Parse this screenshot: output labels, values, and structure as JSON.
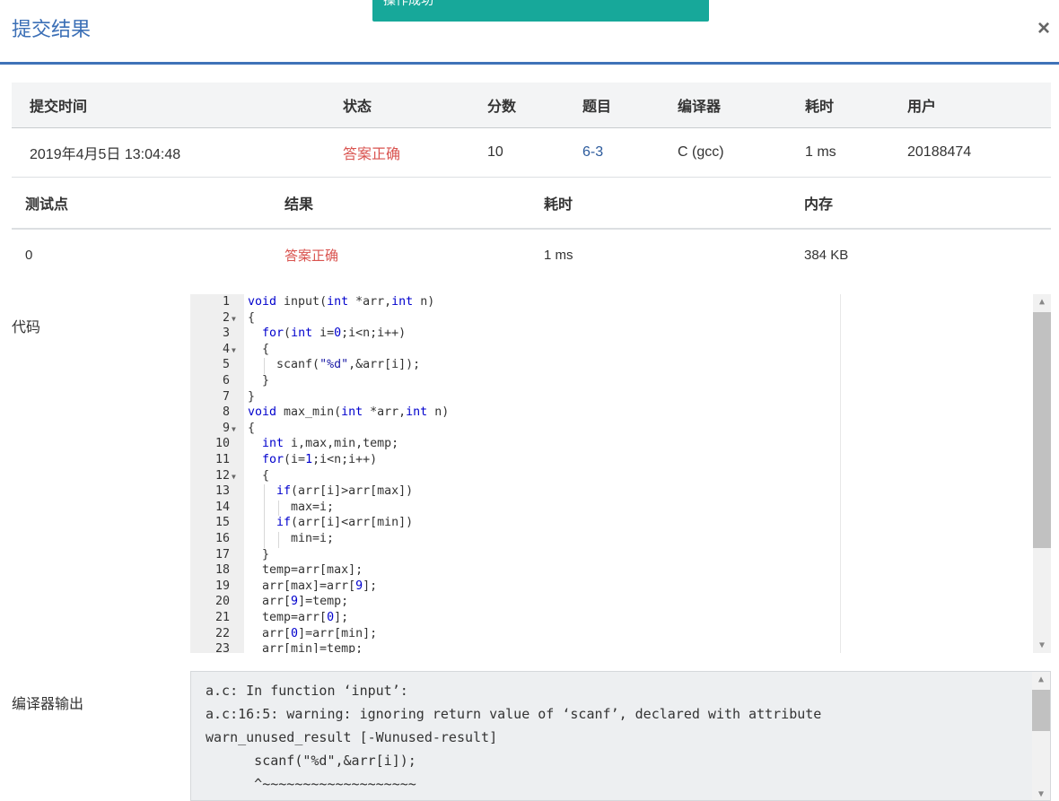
{
  "toast": {
    "text": "操作成功"
  },
  "dialog": {
    "title": "提交结果",
    "close": "×"
  },
  "submission": {
    "headers": [
      "提交时间",
      "状态",
      "分数",
      "题目",
      "编译器",
      "耗时",
      "用户"
    ],
    "row": {
      "time": "2019年4月5日 13:04:48",
      "status": "答案正确",
      "score": "10",
      "problem": "6-3",
      "compiler": "C (gcc)",
      "elapsed": "1 ms",
      "user": "20188474"
    }
  },
  "testcases": {
    "headers": [
      "测试点",
      "结果",
      "耗时",
      "内存"
    ],
    "row": {
      "id": "0",
      "result": "答案正确",
      "elapsed": "1 ms",
      "memory": "384 KB"
    }
  },
  "code_section": {
    "label": "代码",
    "lines": [
      "void input(int *arr,int n)",
      "{",
      "  for(int i=0;i<n;i++)",
      "  {",
      "    scanf(\"%d\",&arr[i]);",
      "  }",
      "}",
      "void max_min(int *arr,int n)",
      "{",
      "  int i,max,min,temp;",
      "  for(i=1;i<n;i++)",
      "  {",
      "    if(arr[i]>arr[max])",
      "      max=i;",
      "    if(arr[i]<arr[min])",
      "      min=i;",
      "  }",
      "  temp=arr[max];",
      "  arr[max]=arr[9];",
      "  arr[9]=temp;",
      "  temp=arr[0];",
      "  arr[0]=arr[min];",
      "  arr[min]=temp;"
    ],
    "fold_lines": [
      2,
      4,
      9,
      12
    ]
  },
  "compiler_output": {
    "label": "编译器输出",
    "lines": [
      "a.c: In function ‘input’:",
      "a.c:16:5: warning: ignoring return value of ‘scanf’, declared with attribute",
      "warn_unused_result [-Wunused-result]",
      "      scanf(\"%d\",&arr[i]);",
      "      ^~~~~~~~~~~~~~~~~~~~"
    ]
  },
  "colors": {
    "accent": "#3b6fb6",
    "success_text": "#d9534f",
    "toast": "#17a89a"
  }
}
